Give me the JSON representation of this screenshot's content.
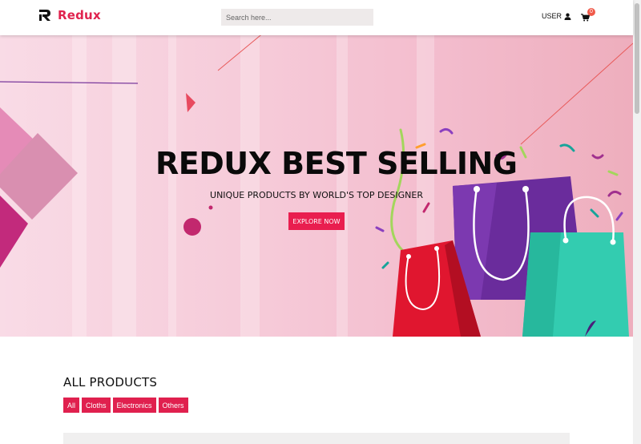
{
  "brand": {
    "name": "Redux",
    "logo_icon": "redux-r-logo",
    "color": "#e0234e"
  },
  "search": {
    "placeholder": "Search here..."
  },
  "header": {
    "user_label": "USER",
    "user_icon": "user-icon",
    "cart_icon": "cart-icon",
    "cart_count": "0"
  },
  "hero": {
    "title": "REDUX BEST SELLING",
    "subtitle": "UNIQUE PRODUCTS BY WORLD'S TOP DESIGNER",
    "cta_label": "EXPLORE NOW",
    "cta_color": "#e91e4f"
  },
  "products": {
    "section_title": "ALL PRODUCTS",
    "filters": [
      "All",
      "Cloths",
      "Electronics",
      "Others"
    ]
  }
}
